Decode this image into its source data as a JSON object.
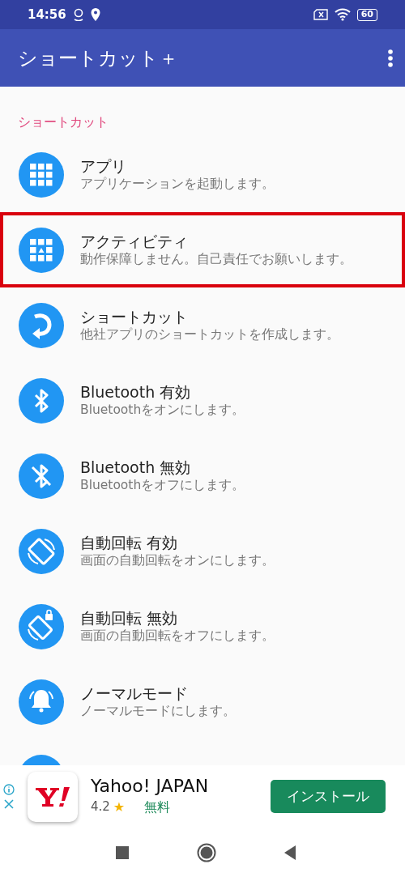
{
  "status_bar": {
    "time": "14:56",
    "battery": "60"
  },
  "app_bar": {
    "title": "ショートカット＋"
  },
  "section": {
    "title": "ショートカット"
  },
  "items": [
    {
      "kind": "apps",
      "title": "アプリ",
      "subtitle": "アプリケーションを起動します。",
      "highlighted": false
    },
    {
      "kind": "activity",
      "title": "アクティビティ",
      "subtitle": "動作保障しません。自己責任でお願いします。",
      "highlighted": true
    },
    {
      "kind": "shortcut",
      "title": "ショートカット",
      "subtitle": "他社アプリのショートカットを作成します。",
      "highlighted": false
    },
    {
      "kind": "bt-on",
      "title": "Bluetooth 有効",
      "subtitle": "Bluetoothをオンにします。",
      "highlighted": false
    },
    {
      "kind": "bt-off",
      "title": "Bluetooth 無効",
      "subtitle": "Bluetoothをオフにします。",
      "highlighted": false
    },
    {
      "kind": "rotate-on",
      "title": "自動回転 有効",
      "subtitle": "画面の自動回転をオンにします。",
      "highlighted": false
    },
    {
      "kind": "rotate-off",
      "title": "自動回転 無効",
      "subtitle": "画面の自動回転をオフにします。",
      "highlighted": false
    },
    {
      "kind": "bell",
      "title": "ノーマルモード",
      "subtitle": "ノーマルモードにします。",
      "highlighted": false
    },
    {
      "kind": "partial"
    }
  ],
  "ad": {
    "app_name": "Yahoo! JAPAN",
    "rating": "4.2",
    "star": "★",
    "price": "無料",
    "button": "インストール"
  }
}
